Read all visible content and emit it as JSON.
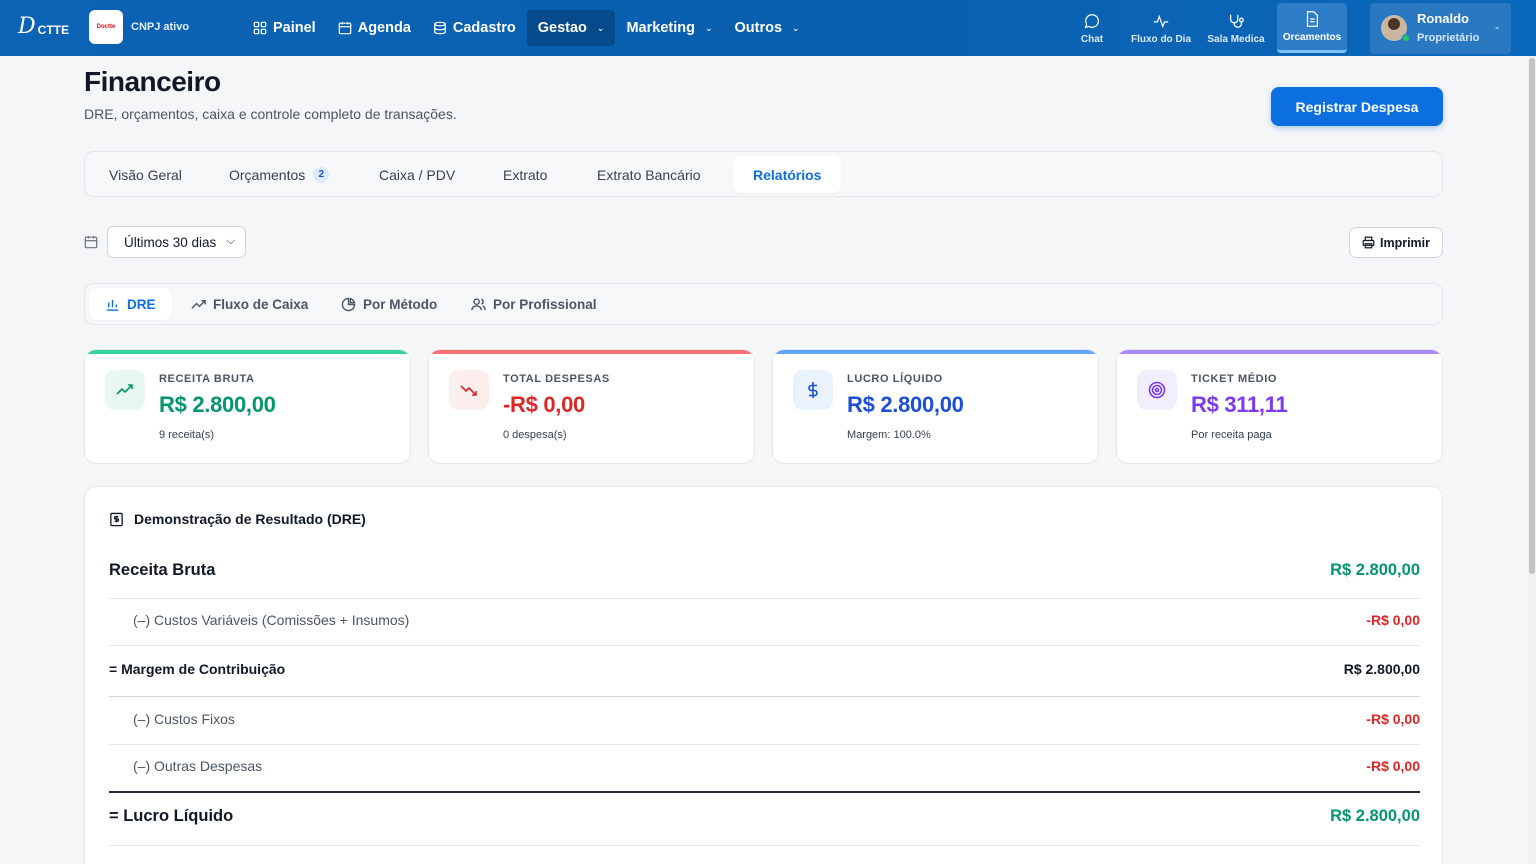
{
  "topbar": {
    "brand": "D",
    "brand_suffix": "CTTE",
    "clinic_logo_text": "Doctte",
    "cnpj_status": "CNPJ ativo",
    "nav": [
      {
        "label": "Painel",
        "icon": "grid-icon"
      },
      {
        "label": "Agenda",
        "icon": "calendar-icon"
      },
      {
        "label": "Cadastro",
        "icon": "database-icon"
      },
      {
        "label": "Gestao",
        "icon": "",
        "dropdown": true,
        "active": true
      },
      {
        "label": "Marketing",
        "icon": "",
        "dropdown": true
      },
      {
        "label": "Outros",
        "icon": "",
        "dropdown": true
      }
    ],
    "quick": [
      {
        "label": "Chat",
        "icon": "chat-icon"
      },
      {
        "label": "Fluxo do Dia",
        "icon": "activity-icon"
      },
      {
        "label": "Sala Medica",
        "icon": "stethoscope-icon"
      },
      {
        "label": "Orcamentos",
        "icon": "document-icon",
        "active": true
      }
    ],
    "user": {
      "name": "Ronaldo",
      "role": "Proprietário"
    }
  },
  "page": {
    "title": "Financeiro",
    "subtitle": "DRE, orçamentos, caixa e controle completo de transações.",
    "primary_action": "Registrar Despesa"
  },
  "tabs": [
    {
      "label": "Visão Geral"
    },
    {
      "label": "Orçamentos",
      "badge": "2"
    },
    {
      "label": "Caixa / PDV"
    },
    {
      "label": "Extrato"
    },
    {
      "label": "Extrato Bancário"
    },
    {
      "label": "Relatórios",
      "active": true
    }
  ],
  "filters": {
    "period": "Últimos 30 dias",
    "print_label": "Imprimir"
  },
  "subtabs": [
    {
      "label": "DRE",
      "icon": "bar-chart-icon",
      "active": true
    },
    {
      "label": "Fluxo de Caixa",
      "icon": "trending-up-icon"
    },
    {
      "label": "Por Método",
      "icon": "pie-chart-icon"
    },
    {
      "label": "Por Profissional",
      "icon": "users-icon"
    }
  ],
  "cards": [
    {
      "label": "RECEITA BRUTA",
      "value": "R$ 2.800,00",
      "note": "9 receita(s)",
      "color": "#059669",
      "accent": "#34d399",
      "icon": "trending-up-icon"
    },
    {
      "label": "TOTAL DESPESAS",
      "value": "-R$ 0,00",
      "note": "0 despesa(s)",
      "color": "#dc2626",
      "accent": "#f87171",
      "icon": "trending-down-icon"
    },
    {
      "label": "LUCRO LÍQUIDO",
      "value": "R$ 2.800,00",
      "note": "Margem: 100.0%",
      "color": "#1d4ed8",
      "accent": "#60a5fa",
      "icon": "dollar-icon"
    },
    {
      "label": "TICKET MÉDIO",
      "value": "R$ 311,11",
      "note": "Por receita paga",
      "color": "#7c3aed",
      "accent": "#a78bfa",
      "icon": "target-icon"
    }
  ],
  "dre": {
    "title": "Demonstração de Resultado (DRE)",
    "rows": [
      {
        "label": "Receita Bruta",
        "value": "R$ 2.800,00"
      },
      {
        "label": "(–) Custos Variáveis (Comissões + Insumos)",
        "value": "-R$ 0,00"
      },
      {
        "label": "= Margem de Contribuição",
        "value": "R$ 2.800,00"
      },
      {
        "label": "(–) Custos Fixos",
        "value": "-R$ 0,00"
      },
      {
        "label": "(–) Outras Despesas",
        "value": "-R$ 0,00"
      },
      {
        "label": "= Lucro Líquido",
        "value": "R$ 2.800,00"
      }
    ]
  }
}
